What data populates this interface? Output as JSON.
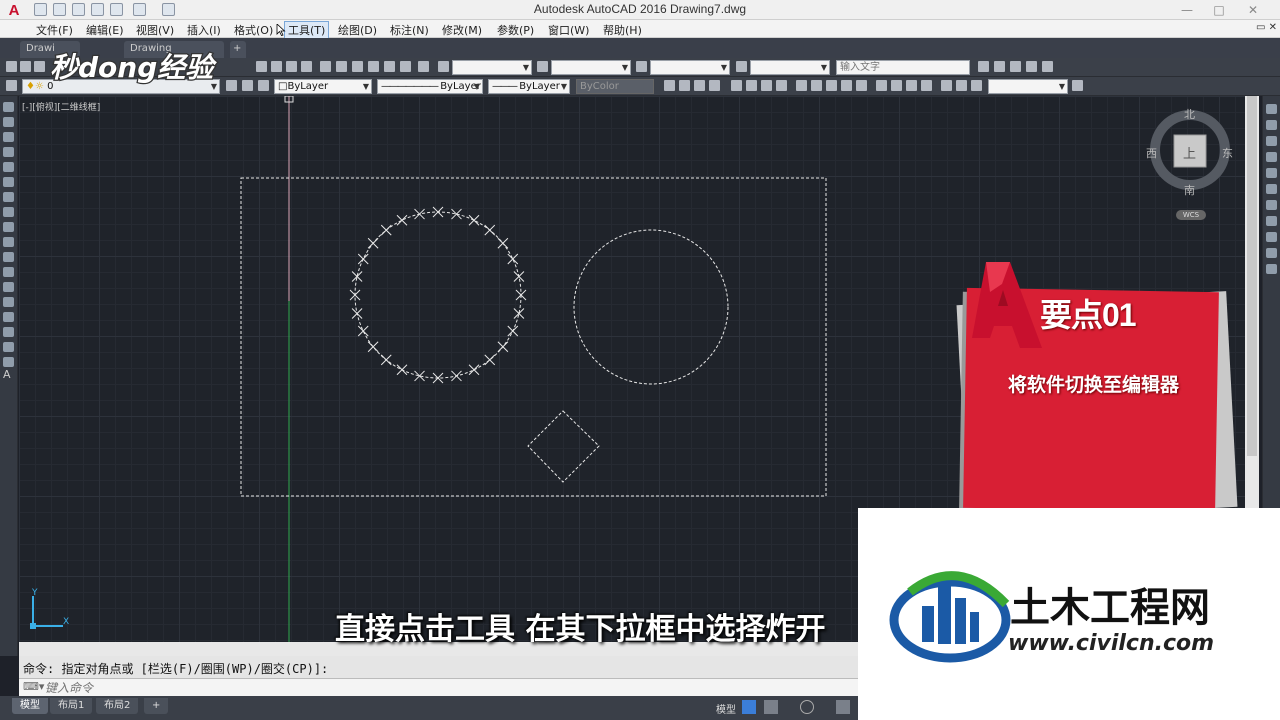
{
  "app": {
    "title": "Autodesk AutoCAD 2016    Drawing7.dwg",
    "logo_letter": "A"
  },
  "menu": [
    {
      "label": "文件(F)"
    },
    {
      "label": "编辑(E)"
    },
    {
      "label": "视图(V)"
    },
    {
      "label": "插入(I)"
    },
    {
      "label": "格式(O)"
    },
    {
      "label": "工具(T)"
    },
    {
      "label": "绘图(D)"
    },
    {
      "label": "标注(N)"
    },
    {
      "label": "修改(M)"
    },
    {
      "label": "参数(P)"
    },
    {
      "label": "窗口(W)"
    },
    {
      "label": "帮助(H)"
    }
  ],
  "tabs": [
    {
      "label": "Drawi"
    },
    {
      "label": "Drawing"
    },
    {
      "label": "+"
    }
  ],
  "toolbar": {
    "layer_value": "0",
    "color_value": "ByLayer",
    "linetype_value": "ByLayer",
    "lineweight_value": "ByLayer",
    "plotstyle_value": "ByColor",
    "search_placeholder": "输入文字"
  },
  "viewport": {
    "label": "[-][俯视][二维线框]"
  },
  "viewcube": {
    "north": "北",
    "south": "南",
    "east": "东",
    "west": "西",
    "top": "上",
    "wcs": "WCS"
  },
  "ucs": {
    "x": "X",
    "y": "Y"
  },
  "tip_card": {
    "title": "要点01",
    "text": "将软件切换至编辑器"
  },
  "subtitle": "直接点击工具 在其下拉框中选择炸开",
  "command": {
    "history": "命令: 指定对角点或 [栏选(F)/圈围(WP)/圈交(CP)]:",
    "placeholder": "键入命令"
  },
  "status": {
    "tabs": [
      {
        "label": "模型"
      },
      {
        "label": "布局1"
      },
      {
        "label": "布局2"
      },
      {
        "label": "+"
      }
    ],
    "model_label": "模型"
  },
  "watermarks": {
    "brand_text": "秒dong经验",
    "civil_name": "土木工程网",
    "civil_url": "www.civilcn.com"
  },
  "colors": {
    "accent_red": "#d81f34",
    "canvas_bg": "#1f232a",
    "civil_blue": "#1b5aa6",
    "civil_green": "#3aa935"
  }
}
